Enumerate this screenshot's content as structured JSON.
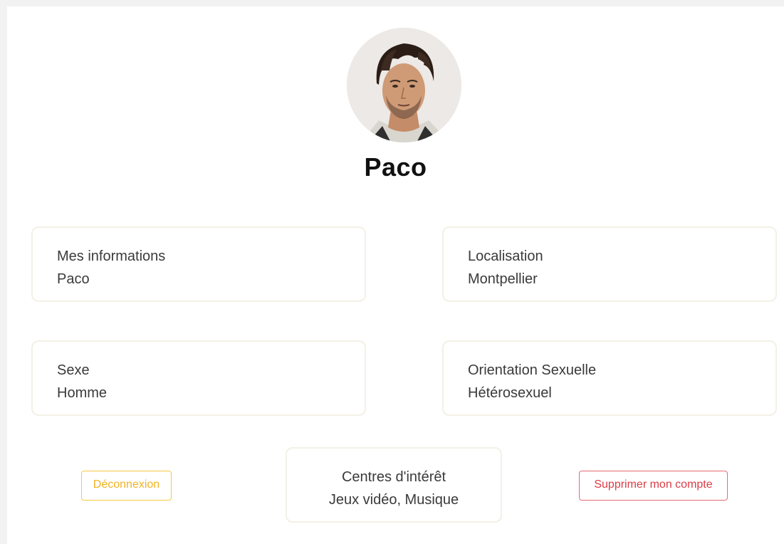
{
  "profile": {
    "name": "Paco",
    "avatar_alt": "profile-photo"
  },
  "cards": {
    "info": {
      "title": "Mes informations",
      "value": "Paco"
    },
    "location": {
      "title": "Localisation",
      "value": "Montpellier"
    },
    "sex": {
      "title": "Sexe",
      "value": "Homme"
    },
    "orientation": {
      "title": "Orientation Sexuelle",
      "value": "Hétérosexuel"
    },
    "interests": {
      "title": "Centres d'intérêt",
      "value": "Jeux vidéo, Musique"
    }
  },
  "actions": {
    "logout_label": "Déconnexion",
    "delete_label": "Supprimer mon compte"
  },
  "colors": {
    "logout": "#f0b323",
    "delete": "#db3c46",
    "card_border": "#f3f0e6",
    "background": "#ffffff"
  }
}
